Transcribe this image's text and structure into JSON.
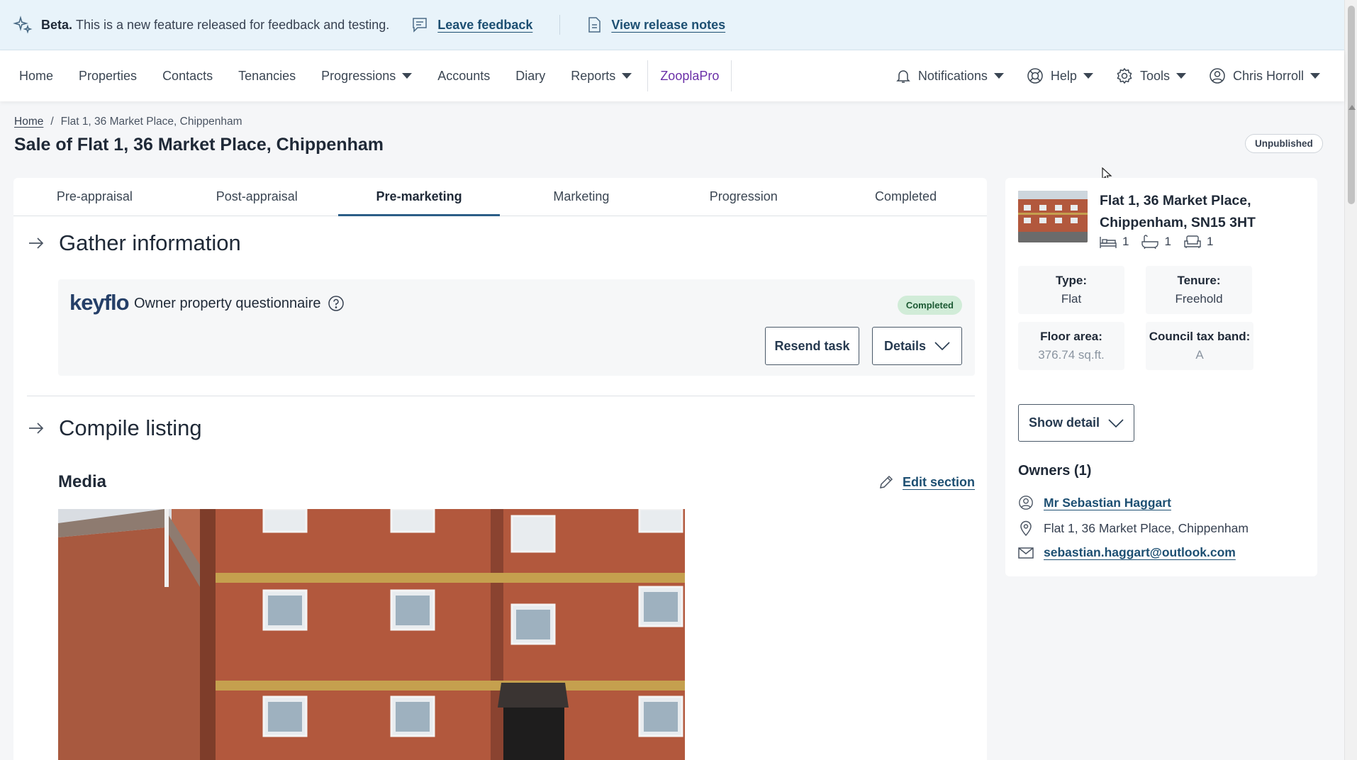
{
  "banner": {
    "beta_label": "Beta.",
    "beta_text": "This is a new feature released for feedback and testing.",
    "feedback_link": "Leave feedback",
    "release_notes_link": "View release notes"
  },
  "nav": {
    "items": [
      "Home",
      "Properties",
      "Contacts",
      "Tenancies",
      "Progressions",
      "Accounts",
      "Diary",
      "Reports",
      "ZooplaPro"
    ],
    "notifications": "Notifications",
    "help": "Help",
    "tools": "Tools",
    "user": "Chris Horroll"
  },
  "breadcrumb": {
    "home": "Home",
    "separator": "/",
    "current": "Flat 1, 36 Market Place, Chippenham"
  },
  "page": {
    "title": "Sale of Flat 1, 36 Market Place, Chippenham",
    "status": "Unpublished"
  },
  "tabs": [
    "Pre-appraisal",
    "Post-appraisal",
    "Pre-marketing",
    "Marketing",
    "Progression",
    "Completed"
  ],
  "active_tab": "Pre-marketing",
  "gather": {
    "title": "Gather information",
    "keyflo_logo": "keyflo",
    "questionnaire_title": "Owner property questionnaire",
    "status": "Completed",
    "resend_button": "Resend task",
    "details_button": "Details"
  },
  "compile": {
    "title": "Compile listing",
    "media_title": "Media",
    "edit_link": "Edit section"
  },
  "property": {
    "address": "Flat 1, 36 Market Place, Chippenham, SN15 3HT",
    "bedrooms": "1",
    "bathrooms": "1",
    "receptions": "1",
    "type_label": "Type:",
    "type_value": "Flat",
    "tenure_label": "Tenure:",
    "tenure_value": "Freehold",
    "floor_area_label": "Floor area:",
    "floor_area_value": "376.74 sq.ft.",
    "council_tax_label": "Council tax band:",
    "council_tax_value": "A",
    "show_detail_button": "Show detail"
  },
  "owners": {
    "title": "Owners (1)",
    "name": "Mr Sebastian Haggart",
    "address": "Flat 1, 36 Market Place, Chippenham",
    "email": "sebastian.haggart@outlook.com"
  },
  "colors": {
    "banner_bg": "#e8f3fa",
    "accent_blue": "#1d4f72",
    "zoopla_purple": "#6a2fa7",
    "completed_badge_bg": "#d1ecd8",
    "tab_underline": "#2b5e87"
  }
}
